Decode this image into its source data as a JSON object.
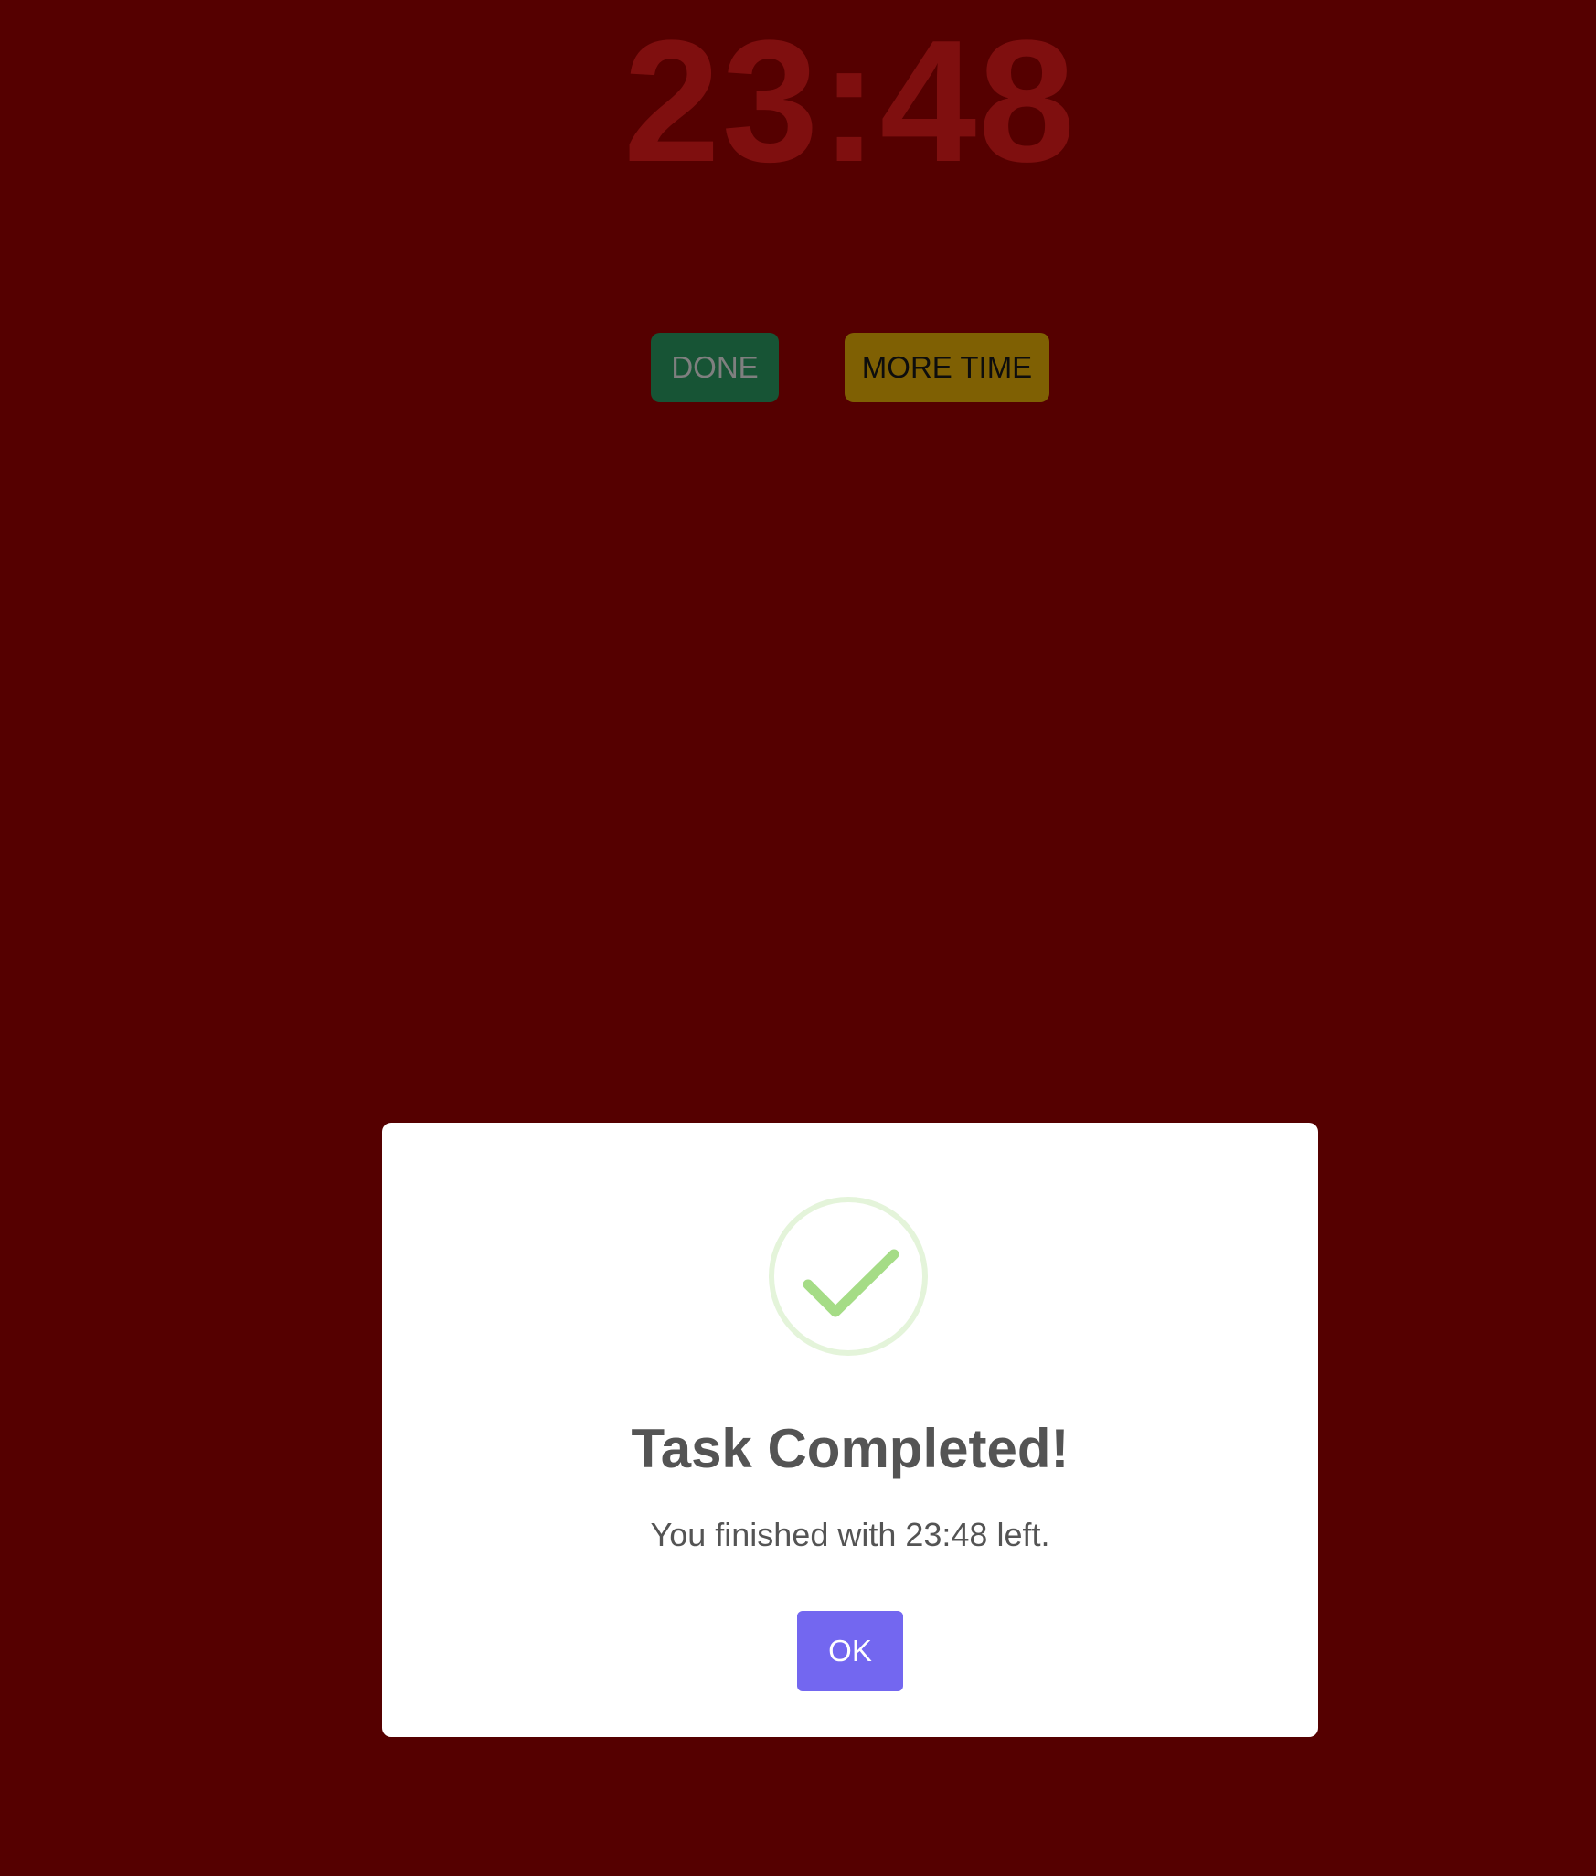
{
  "timer": {
    "display": "23:48"
  },
  "actions": {
    "done_label": "DONE",
    "more_time_label": "MORE TIME"
  },
  "modal": {
    "icon": "check-circle-icon",
    "title": "Task Completed!",
    "message": "You finished with 23:48 left.",
    "ok_label": "OK"
  },
  "colors": {
    "background": "#ab0000",
    "timer": "#ff1f1f",
    "done_button": "#2ea86a",
    "more_time_button": "#ffc107",
    "ok_button": "#7367f0",
    "success_check": "#a5dc86"
  }
}
